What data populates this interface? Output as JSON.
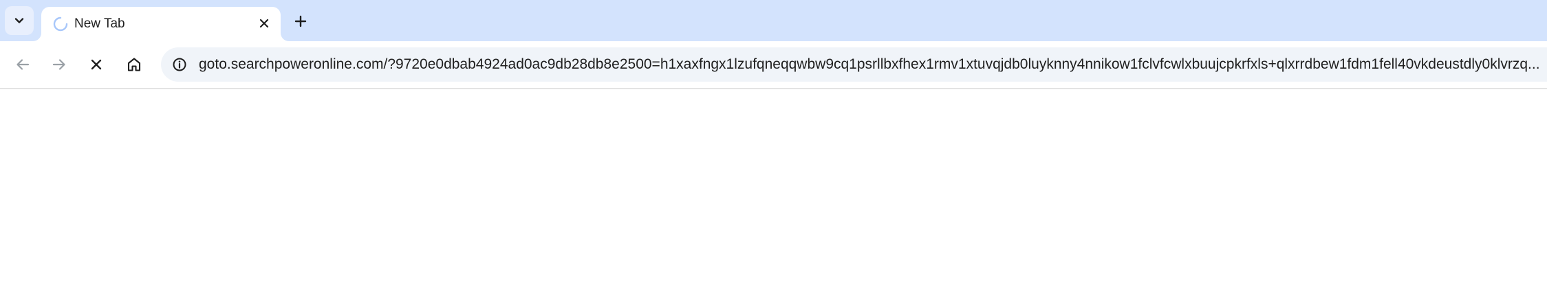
{
  "colors": {
    "tabstrip_bg": "#d3e3fd",
    "omnibox_bg": "#f0f4f9",
    "icon_color": "#1f1f1f",
    "disabled_icon_color": "#9aa0a6"
  },
  "tabstrip": {
    "search_tabs_icon": "chevron-down-icon",
    "active_tab": {
      "title": "New Tab",
      "loading_icon": "loading-spinner-icon",
      "close_icon": "close-icon"
    },
    "new_tab_icon": "plus-icon"
  },
  "toolbar": {
    "back_icon": "arrow-left-icon",
    "forward_icon": "arrow-right-icon",
    "stop_icon": "close-icon",
    "home_icon": "home-icon",
    "omnibox": {
      "site_info_icon": "info-icon",
      "url": "goto.searchpoweronline.com/?9720e0dbab4924ad0ac9db28db8e2500=h1xaxfngx1lzufqneqqwbw9cq1psrllbxfhex1rmv1xtuvqjdb0luyknny4nnikow1fclvfcwlxbuujcpkrfxls+qlxrrdbew1fdm1fell40vkdeustdly0klvrzq..."
    }
  }
}
